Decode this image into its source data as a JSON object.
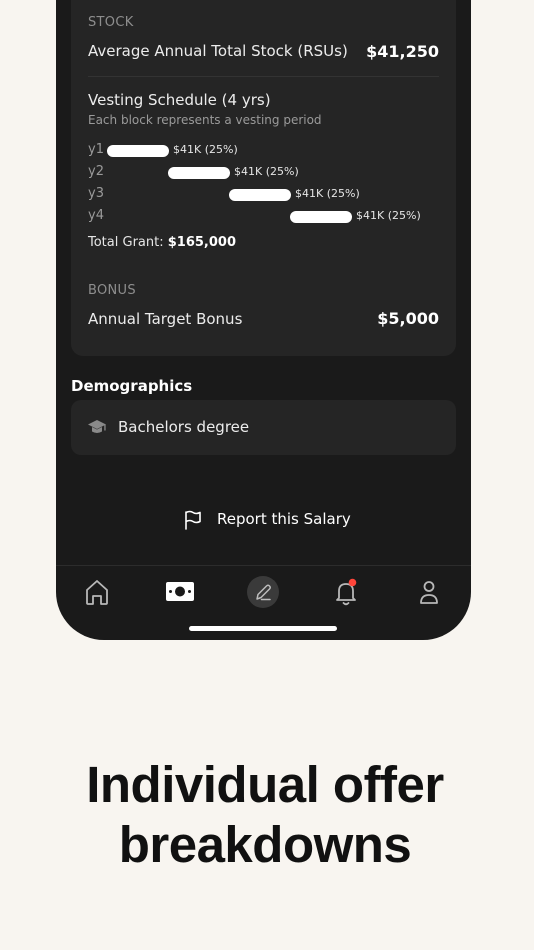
{
  "stock": {
    "section_label": "STOCK",
    "row_label": "Average Annual Total Stock (RSUs)",
    "row_value": "$41,250"
  },
  "vesting": {
    "title": "Vesting Schedule (4 yrs)",
    "subtitle": "Each block represents a vesting period",
    "years": [
      {
        "label": "y1",
        "amount": "$41K",
        "percent": "(25%)"
      },
      {
        "label": "y2",
        "amount": "$41K",
        "percent": "(25%)"
      },
      {
        "label": "y3",
        "amount": "$41K",
        "percent": "(25%)"
      },
      {
        "label": "y4",
        "amount": "$41K",
        "percent": "(25%)"
      }
    ],
    "total_label": "Total Grant:",
    "total_value": "$165,000"
  },
  "bonus": {
    "section_label": "BONUS",
    "row_label": "Annual Target Bonus",
    "row_value": "$5,000"
  },
  "demographics": {
    "heading": "Demographics",
    "education": "Bachelors degree",
    "education_icon": "graduation-cap-icon"
  },
  "report": {
    "label": "Report this Salary",
    "icon": "flag-icon"
  },
  "nav": {
    "items": [
      "home-icon",
      "money-icon",
      "edit-icon",
      "bell-icon",
      "user-icon"
    ],
    "active": "money-icon",
    "notification_dot_color": "#ff453a"
  },
  "headline": {
    "line1": "Individual offer",
    "line2": "breakdowns"
  },
  "colors": {
    "page_bg": "#f8f5f0",
    "phone_bg": "#1a1a1a",
    "card_bg": "#252525"
  }
}
